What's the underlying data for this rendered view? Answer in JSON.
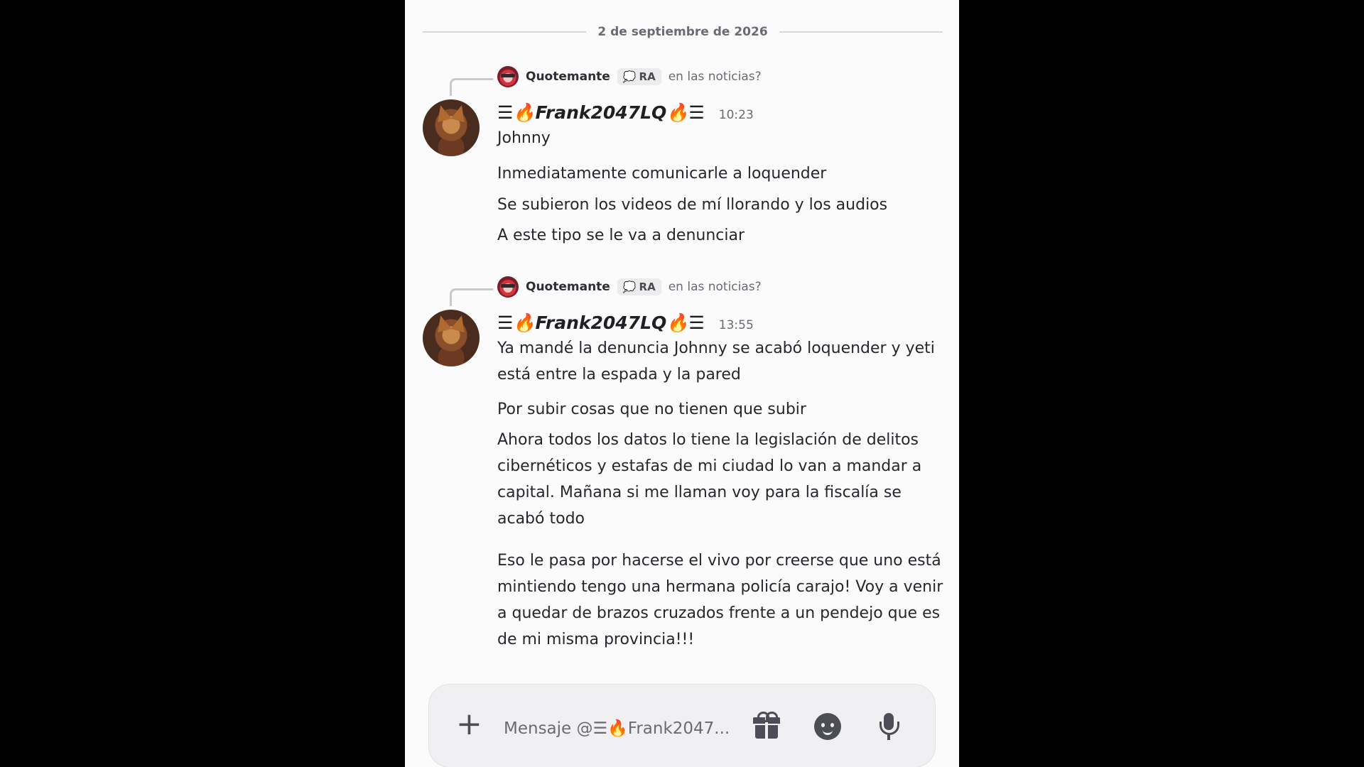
{
  "date_divider": "2 de septiembre de 2026",
  "messages": [
    {
      "reply": {
        "author": "Quotemante",
        "tag": "RA",
        "snippet": "en las noticias?"
      },
      "username": "☰🔥Frank2047LQ🔥☰",
      "time": "10:23",
      "lines": [
        "Johnny",
        "Inmediatamente comunicarle a loquender",
        "Se subieron los videos de mí llorando y los audios",
        "A este tipo se le va a denunciar"
      ]
    },
    {
      "reply": {
        "author": "Quotemante",
        "tag": "RA",
        "snippet": "en las noticias?"
      },
      "username": "☰🔥Frank2047LQ🔥☰",
      "time": "13:55",
      "lines": [
        "Ya mandé la denuncia Johnny se acabó loquender y yeti está entre la espada y la pared",
        "Por subir cosas que no tienen que subir",
        "Ahora todos los datos lo tiene la legislación de delitos cibernéticos y estafas de mi ciudad lo van a mandar a capital. Mañana si me llaman voy para la fiscalía se acabó todo",
        "Eso le pasa por hacerse el vivo por creerse que uno está mintiendo tengo una hermana policía carajo! Voy a venir a quedar de brazos cruzados frente a un pendejo que es de mi misma provincia!!!"
      ]
    }
  ],
  "composer": {
    "placeholder": "Mensaje @☰🔥Frank2047...",
    "plus_icon": "+",
    "icons": [
      "plus-icon",
      "gift-icon",
      "emoji-icon",
      "microphone-icon"
    ]
  }
}
